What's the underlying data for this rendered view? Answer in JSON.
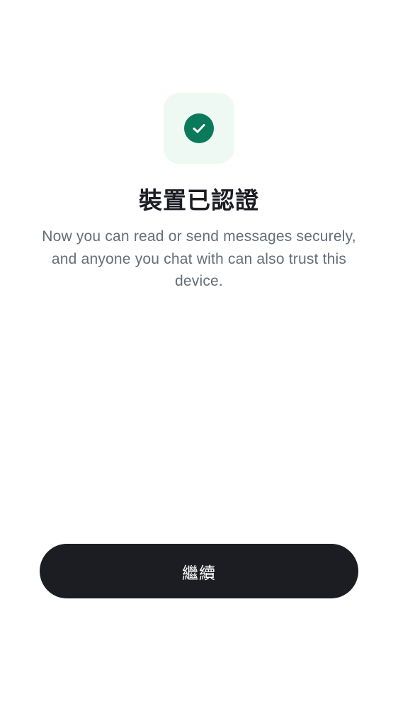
{
  "header": {
    "icon": "check-circle-icon",
    "title": "裝置已認證"
  },
  "body": {
    "description": "Now you can read or send messages securely, and anyone you chat with can also trust this device."
  },
  "actions": {
    "continue_label": "繼續"
  },
  "colors": {
    "background": "#ffffff",
    "icon_tile": "#eff9f3",
    "success_green": "#0b7a5a",
    "text_primary": "#1b1d22",
    "text_secondary": "#656d77",
    "button_background": "#1b1d22",
    "button_text": "#ffffff"
  }
}
